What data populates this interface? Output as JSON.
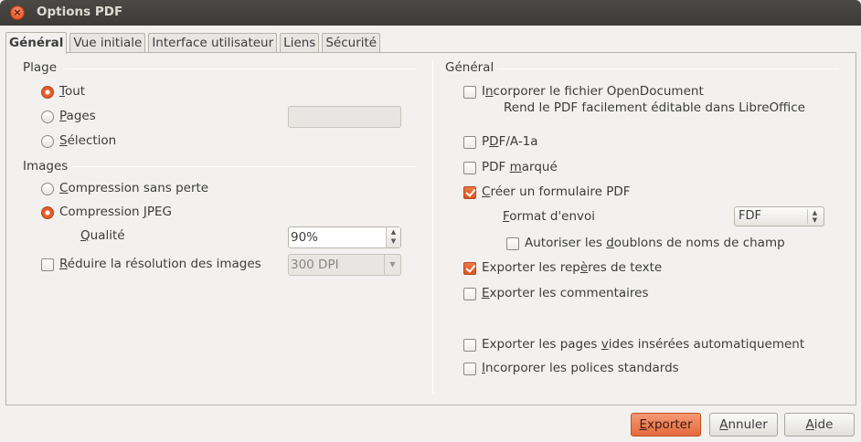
{
  "window": {
    "title": "Options PDF"
  },
  "tabs": [
    {
      "label": "Général",
      "active": true
    },
    {
      "label": "Vue initiale",
      "active": false
    },
    {
      "label": "Interface utilisateur",
      "active": false
    },
    {
      "label": "Liens",
      "active": false
    },
    {
      "label": "Sécurité",
      "active": false
    }
  ],
  "left": {
    "plage": {
      "title": "Plage",
      "tout": {
        "pre": "",
        "acc": "T",
        "post": "out",
        "selected": true
      },
      "pages": {
        "pre": "",
        "acc": "P",
        "post": "ages",
        "selected": false,
        "value": ""
      },
      "selection": {
        "pre": "",
        "acc": "S",
        "post": "élection",
        "selected": false
      }
    },
    "images": {
      "title": "Images",
      "sans_perte": {
        "pre": "",
        "acc": "C",
        "post": "ompression sans perte",
        "selected": false
      },
      "jpeg": {
        "pre": "Compression ",
        "acc": "J",
        "post": "PEG",
        "selected": true
      },
      "qualite": {
        "pre": "",
        "acc": "Q",
        "post": "ualité",
        "value": "90%"
      },
      "reduire": {
        "pre": "",
        "acc": "R",
        "post": "éduire la résolution des images",
        "checked": false,
        "value": "300 DPI"
      }
    }
  },
  "right": {
    "title": "Général",
    "opendoc": {
      "pre": "I",
      "acc": "n",
      "post": "corporer le fichier OpenDocument",
      "checked": false,
      "desc": "Rend le PDF facilement éditable dans LibreOffice"
    },
    "pdfa": {
      "pre": "P",
      "acc": "D",
      "post": "F/A-1a",
      "checked": false
    },
    "marque": {
      "pre": "PDF ",
      "acc": "m",
      "post": "arqué",
      "checked": false
    },
    "formulaire": {
      "pre": "",
      "acc": "C",
      "post": "réer un formulaire PDF",
      "checked": true
    },
    "format_envoi": {
      "pre": "",
      "acc": "F",
      "post": "ormat d'envoi",
      "value": "FDF"
    },
    "doublons": {
      "pre": "Autoriser les ",
      "acc": "d",
      "post": "oublons de noms de champ",
      "checked": false
    },
    "reperes": {
      "pre": "Exporter les rep",
      "acc": "è",
      "post": "res de texte",
      "checked": true
    },
    "commentaires": {
      "pre": "",
      "acc": "E",
      "post": "xporter les commentaires",
      "checked": false
    },
    "pages_vides": {
      "pre": "Exporter les pages ",
      "acc": "v",
      "post": "ides insérées automatiquement",
      "checked": false
    },
    "polices": {
      "pre": "",
      "acc": "I",
      "post": "ncorporer les polices standards",
      "checked": false
    }
  },
  "buttons": {
    "exporter": {
      "pre": "",
      "acc": "E",
      "post": "xporter"
    },
    "annuler": {
      "pre": "",
      "acc": "A",
      "post": "nnuler"
    },
    "aide": {
      "pre": "",
      "acc": "A",
      "post": "ide"
    }
  }
}
